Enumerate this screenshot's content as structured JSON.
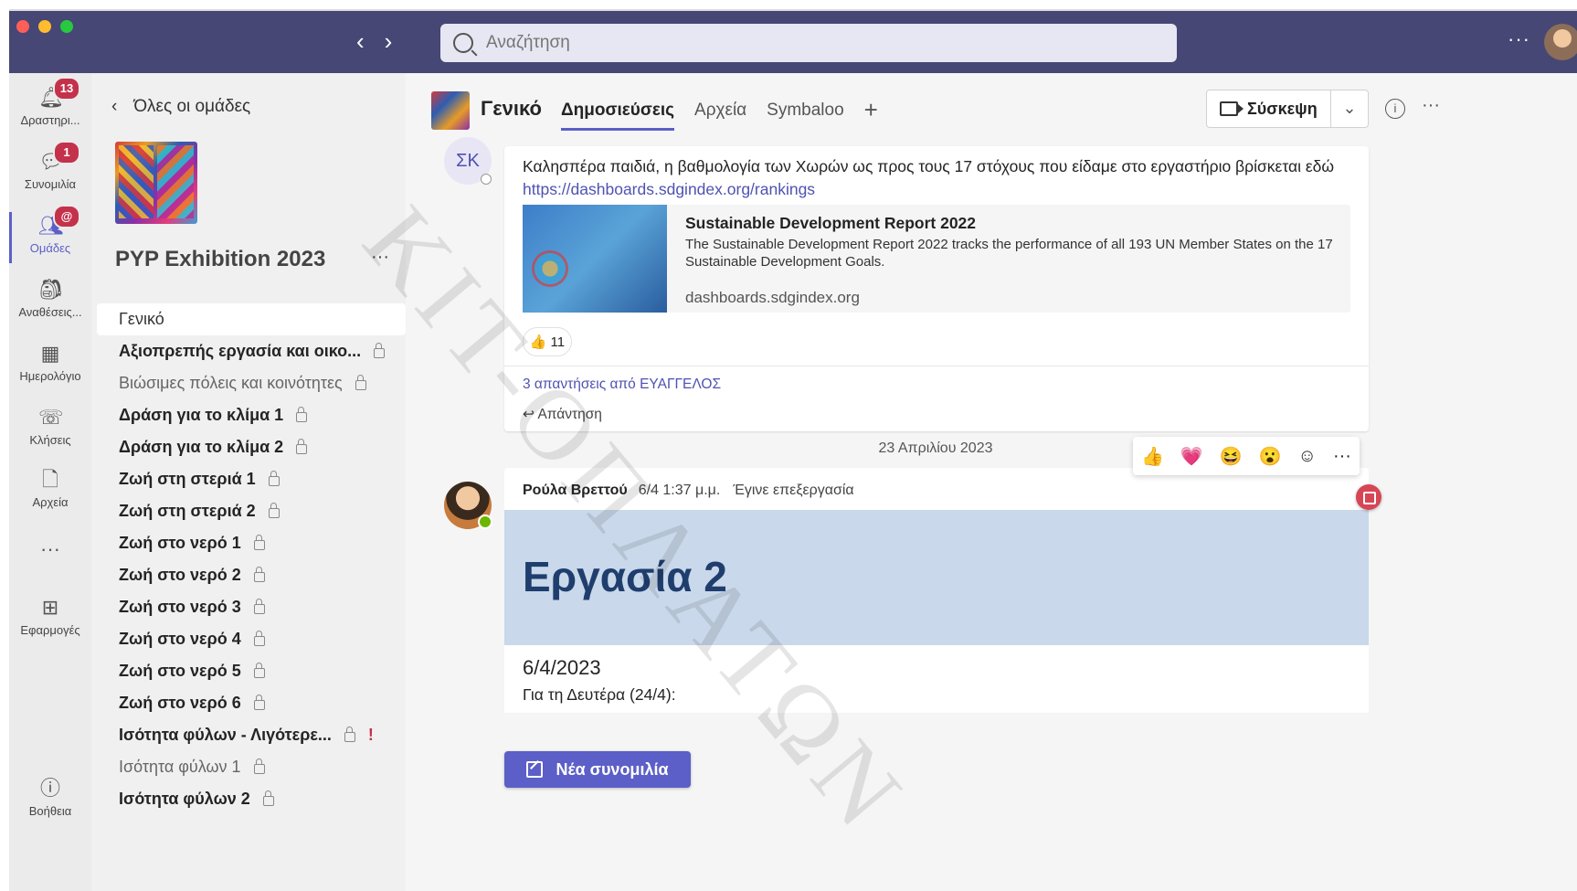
{
  "titlebar": {
    "traffic_colors": [
      "#ff5f57",
      "#febc2e",
      "#28c840"
    ],
    "search_placeholder": "Αναζήτηση",
    "more": "···"
  },
  "rail": {
    "items": [
      {
        "label": "Δραστηρι...",
        "icon": "bell-icon",
        "badge": "13"
      },
      {
        "label": "Συνομιλία",
        "icon": "chat-icon",
        "badge": "1"
      },
      {
        "label": "Ομάδες",
        "icon": "teams-icon",
        "badge": "@"
      },
      {
        "label": "Αναθέσεις...",
        "icon": "backpack-icon"
      },
      {
        "label": "Ημερολόγιο",
        "icon": "calendar-icon"
      },
      {
        "label": "Κλήσεις",
        "icon": "phone-icon"
      },
      {
        "label": "Αρχεία",
        "icon": "file-icon"
      },
      {
        "label": "···",
        "icon": "more-icon"
      },
      {
        "label": "Εφαρμογές",
        "icon": "apps-icon"
      },
      {
        "label": "Βοήθεια",
        "icon": "help-icon"
      }
    ]
  },
  "teams_panel": {
    "back_label": "Όλες οι ομάδες",
    "team_name": "PYP Exhibition 2023",
    "more": "···",
    "channels": [
      {
        "name": "Γενικό",
        "style": "selected"
      },
      {
        "name": "Αξιοπρεπής εργασία και οικο...",
        "style": "bold",
        "private": true
      },
      {
        "name": "Βιώσιμες πόλεις και κοινότητες",
        "style": "dim",
        "private": true
      },
      {
        "name": "Δράση για το κλίμα 1",
        "style": "bold",
        "private": true
      },
      {
        "name": "Δράση για το κλίμα 2",
        "style": "bold",
        "private": true
      },
      {
        "name": "Ζωή στη στεριά 1",
        "style": "bold",
        "private": true
      },
      {
        "name": "Ζωή στη στεριά 2",
        "style": "bold",
        "private": true
      },
      {
        "name": "Ζωή στο νερό 1",
        "style": "bold",
        "private": true
      },
      {
        "name": "Ζωή στο νερό 2",
        "style": "bold",
        "private": true
      },
      {
        "name": "Ζωή στο νερό 3",
        "style": "bold",
        "private": true
      },
      {
        "name": "Ζωή στο νερό 4",
        "style": "bold",
        "private": true
      },
      {
        "name": "Ζωή στο νερό 5",
        "style": "bold",
        "private": true
      },
      {
        "name": "Ζωή στο νερό 6",
        "style": "bold",
        "private": true
      },
      {
        "name": "Ισότητα φύλων - Λιγότερε...",
        "style": "bold",
        "private": true,
        "alert": "!"
      },
      {
        "name": "Ισότητα φύλων 1",
        "style": "dim",
        "private": true
      },
      {
        "name": "Ισότητα φύλων 2",
        "style": "bold",
        "private": true
      }
    ]
  },
  "channel_header": {
    "title": "Γενικό",
    "tabs": [
      "Δημοσιεύσεις",
      "Αρχεία",
      "Symbaloo"
    ],
    "add_tab": "+",
    "meet_label": "Σύσκεψη",
    "meet_dropdown": "⌄",
    "info": "i",
    "more": "···"
  },
  "post1": {
    "author_initials": "ΣΚ",
    "text": "Καλησπέρα παιδιά, η βαθμολογία των Χωρών ως προς τους 17 στόχους που είδαμε στο εργαστήριο βρίσκεται εδώ",
    "link": "https://dashboards.sdgindex.org/rankings",
    "card": {
      "title": "Sustainable Development Report 2022",
      "description": "The Sustainable Development Report 2022 tracks the performance of all 193 UN Member States on the 17 Sustainable Development Goals.",
      "domain": "dashboards.sdgindex.org"
    },
    "reaction_emoji": "👍",
    "reaction_count": "11",
    "replies_label": "3 απαντήσεις από ΕΥΑΓΓΕΛΟΣ",
    "reply_label": "Απάντηση"
  },
  "date_divider": "23 Απριλίου 2023",
  "reaction_bar": [
    "👍",
    "💗",
    "😆",
    "😮",
    "☺",
    "···"
  ],
  "post2": {
    "author": "Ρούλα Βρεττού",
    "time": "6/4 1:37 μ.μ.",
    "edited": "Έγινε επεξεργασία",
    "banner_title": "Εργασία 2",
    "date": "6/4/2023",
    "line": "Για τη Δευτέρα (24/4):"
  },
  "new_conversation_label": "Νέα συνομιλία",
  "watermark": "ΚΙΤ-ΟΠΛΑΤΩΝ"
}
